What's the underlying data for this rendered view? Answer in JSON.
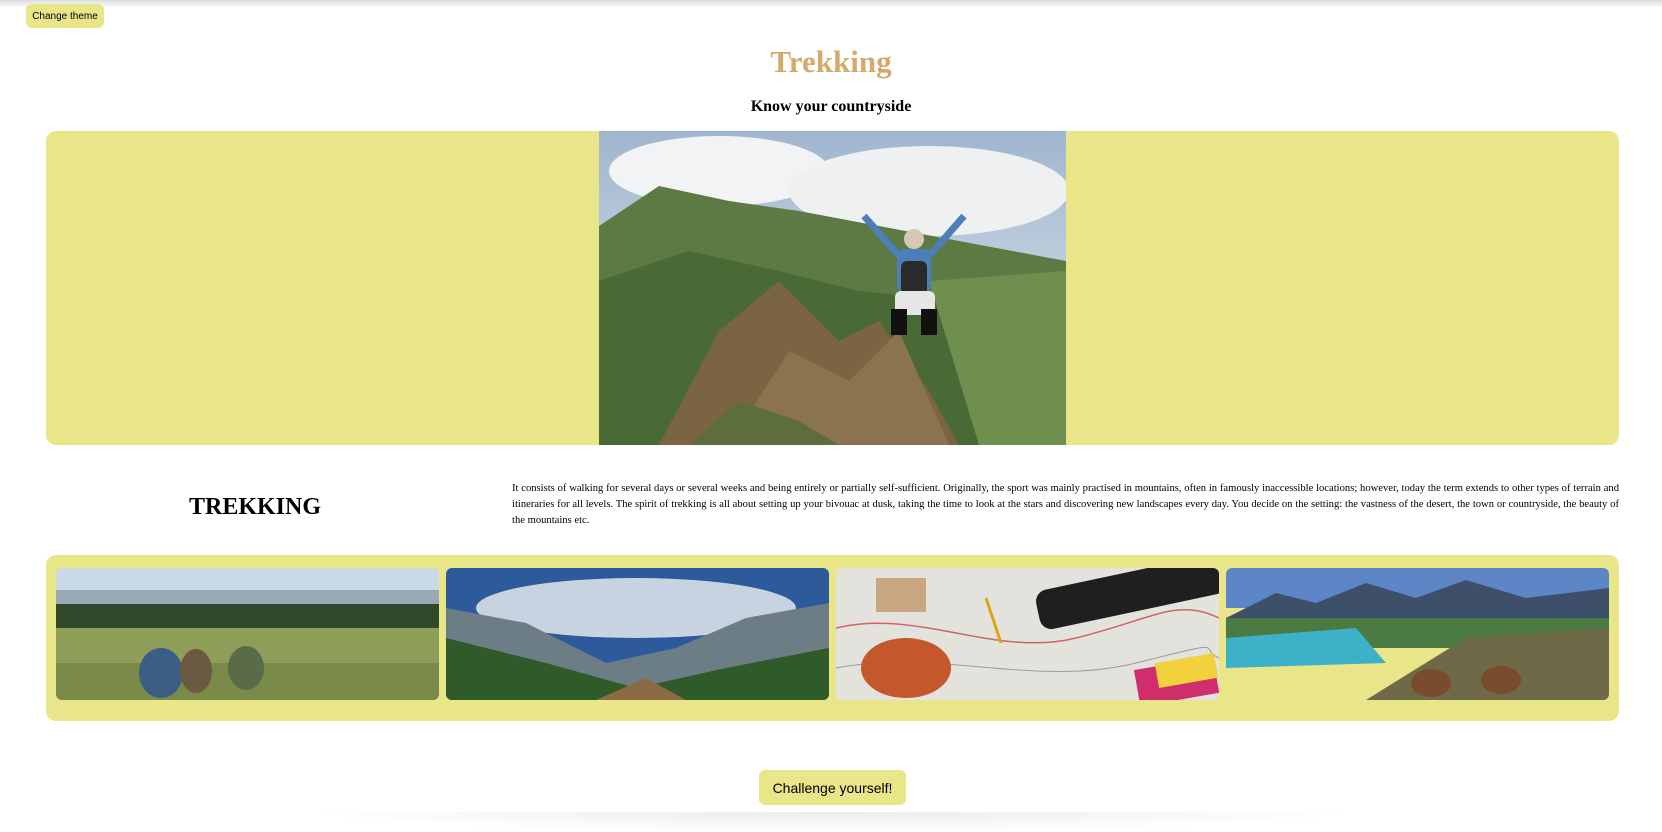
{
  "header": {
    "theme_button_label": "Change theme",
    "title": "Trekking",
    "subtitle": "Know your countryside"
  },
  "hero": {
    "image": "hiker-on-mountain-peak-photo"
  },
  "section": {
    "heading": "TREKKING",
    "paragraph": "It consists of walking for several days or several weeks and being entirely or partially self-sufficient. Originally, the sport was mainly practised in mountains, often in famously inaccessible locations; however, today the term extends to other types of terrain and itineraries for all levels. The spirit of trekking is all about setting up your bivouac at dusk, taking the time to look at the stars and discovering new landscapes every day. You decide on the setting: the vastness of the desert, the town or countryside, the beauty of the mountains etc."
  },
  "gallery": {
    "images": [
      "group-hiking-grassland-photo",
      "mountain-valley-trail-photo",
      "map-and-gear-flatlay-photo",
      "boots-over-lake-view-photo"
    ]
  },
  "cta": {
    "label": "Challenge yourself!"
  },
  "colors": {
    "accent": "#e9e589",
    "title": "#d4a96c"
  }
}
